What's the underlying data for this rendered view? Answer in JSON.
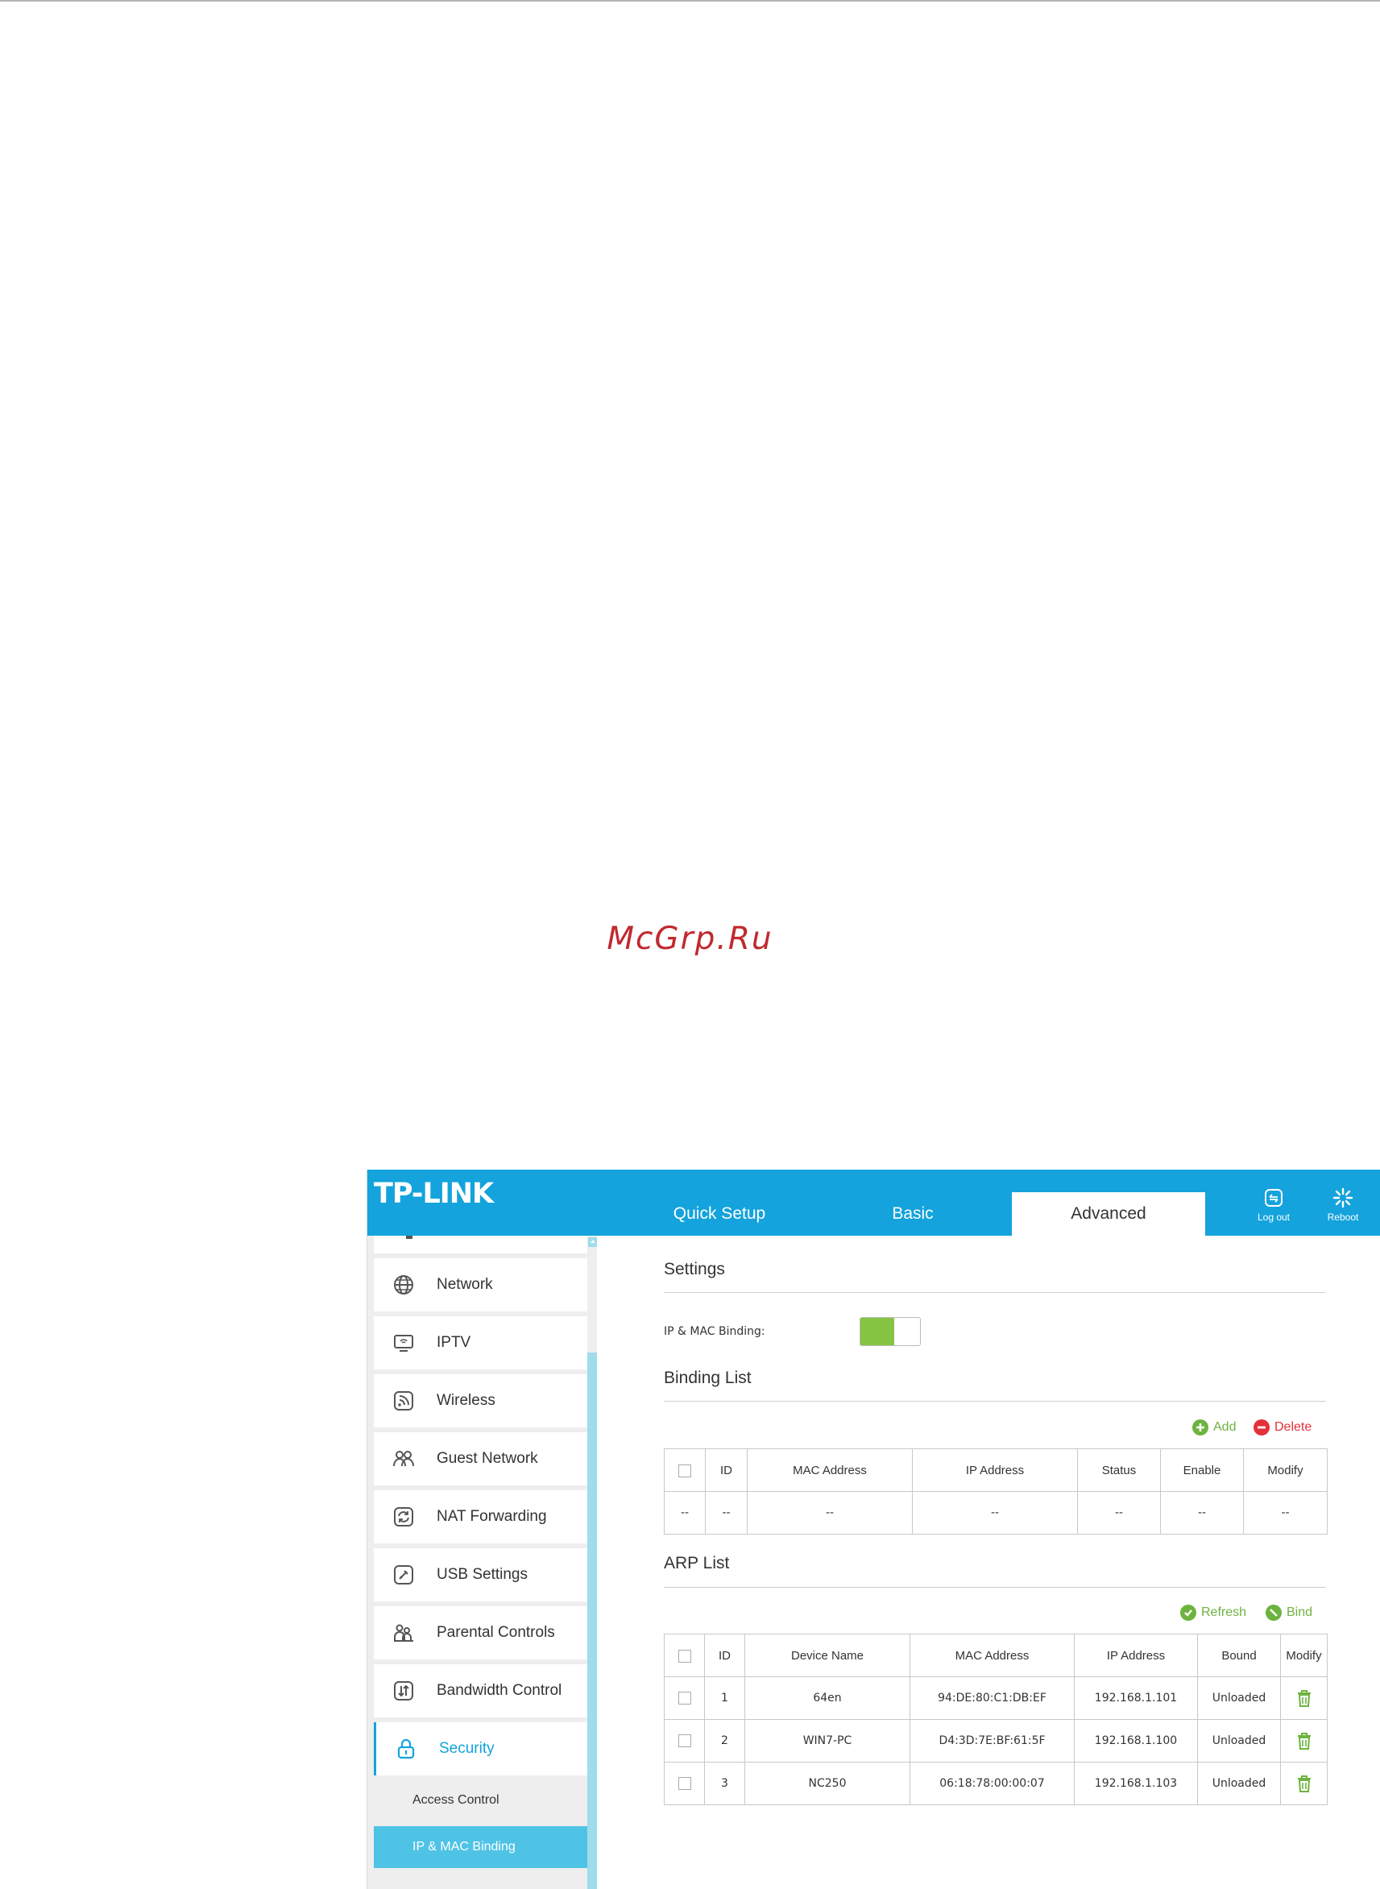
{
  "watermark": "McGrp.Ru",
  "header": {
    "logo": "TP-LINK",
    "tabs": [
      "Quick Setup",
      "Basic",
      "Advanced"
    ],
    "active_tab": "Advanced",
    "logout_label": "Log out",
    "reboot_label": "Reboot"
  },
  "sidebar": {
    "items": [
      {
        "label": "Network",
        "icon": "globe-icon"
      },
      {
        "label": "IPTV",
        "icon": "tv-icon"
      },
      {
        "label": "Wireless",
        "icon": "wireless-icon"
      },
      {
        "label": "Guest Network",
        "icon": "guest-network-icon"
      },
      {
        "label": "NAT Forwarding",
        "icon": "nat-forwarding-icon"
      },
      {
        "label": "USB Settings",
        "icon": "usb-icon"
      },
      {
        "label": "Parental Controls",
        "icon": "parental-controls-icon"
      },
      {
        "label": "Bandwidth Control",
        "icon": "bandwidth-icon"
      },
      {
        "label": "Security",
        "icon": "lock-icon"
      }
    ],
    "active_item": "Security",
    "sub_items": [
      "Access Control",
      "IP & MAC Binding"
    ],
    "selected_sub_item": "IP & MAC Binding"
  },
  "settings": {
    "title": "Settings",
    "binding_label": "IP & MAC Binding:",
    "binding_enabled": true
  },
  "binding_list": {
    "title": "Binding List",
    "add_label": "Add",
    "delete_label": "Delete",
    "columns": [
      "ID",
      "MAC Address",
      "IP Address",
      "Status",
      "Enable",
      "Modify"
    ],
    "empty_row": [
      "--",
      "--",
      "--",
      "--",
      "--",
      "--",
      "--"
    ]
  },
  "arp_list": {
    "title": "ARP List",
    "refresh_label": "Refresh",
    "bind_label": "Bind",
    "columns": [
      "ID",
      "Device Name",
      "MAC Address",
      "IP Address",
      "Bound",
      "Modify"
    ],
    "rows": [
      {
        "id": "1",
        "device": "64en",
        "mac": "94:DE:80:C1:DB:EF",
        "ip": "192.168.1.101",
        "bound": "Unloaded"
      },
      {
        "id": "2",
        "device": "WIN7-PC",
        "mac": "D4:3D:7E:BF:61:5F",
        "ip": "192.168.1.100",
        "bound": "Unloaded"
      },
      {
        "id": "3",
        "device": "NC250",
        "mac": "06:18:78:00:00:07",
        "ip": "192.168.1.103",
        "bound": "Unloaded"
      }
    ]
  },
  "colors": {
    "brand_blue": "#14a3dc",
    "accent_green": "#86c443",
    "delete_red": "#e4303a",
    "selected_sub_bg": "#4fc3e6"
  }
}
